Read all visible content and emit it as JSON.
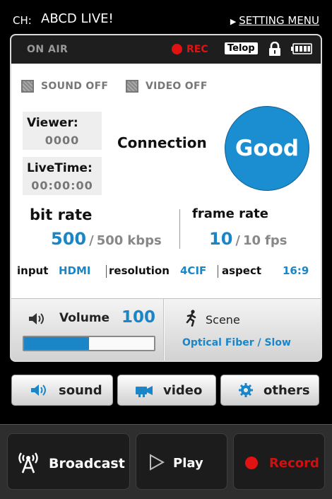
{
  "header": {
    "channel_label": "CH:",
    "channel_name": "ABCD LIVE!",
    "setting_menu": "SETTING MENU"
  },
  "status": {
    "on_air": "ON AIR",
    "rec": "REC",
    "telop": "Telop"
  },
  "toggles": {
    "sound": "SOUND OFF",
    "video": "VIDEO OFF"
  },
  "stats": {
    "viewer_label": "Viewer:",
    "viewer_value": "0000",
    "livetime_label": "LiveTime:",
    "livetime_value": "00:00:00",
    "connection_label": "Connection",
    "connection_status": "Good"
  },
  "bitrate": {
    "label": "bit rate",
    "current": "500",
    "max": "500",
    "unit": "kbps"
  },
  "framerate": {
    "label": "frame rate",
    "current": "10",
    "max": "10",
    "unit": "fps"
  },
  "specs": {
    "input_label": "input",
    "input_value": "HDMI",
    "resolution_label": "resolution",
    "resolution_value": "4CIF",
    "aspect_label": "aspect",
    "aspect_value": "16:9"
  },
  "volume": {
    "label": "Volume",
    "value": "100",
    "level_fraction": 0.5
  },
  "scene": {
    "label": "Scene",
    "value": "Optical Fiber / Slow"
  },
  "tabs": {
    "sound": "sound",
    "video": "video",
    "others": "others"
  },
  "actions": {
    "broadcast": "Broadcast",
    "play": "Play",
    "record": "Record"
  },
  "colors": {
    "accent": "#1a86c8",
    "rec": "#e01212",
    "good": "#1b8ed2"
  },
  "icons": {
    "sound": "speaker-icon",
    "video": "camera-icon",
    "others": "gear-icon",
    "broadcast": "antenna-icon",
    "play": "play-icon",
    "record": "record-dot-icon",
    "scene": "running-person-icon",
    "lock": "lock-icon",
    "battery": "battery-icon"
  }
}
